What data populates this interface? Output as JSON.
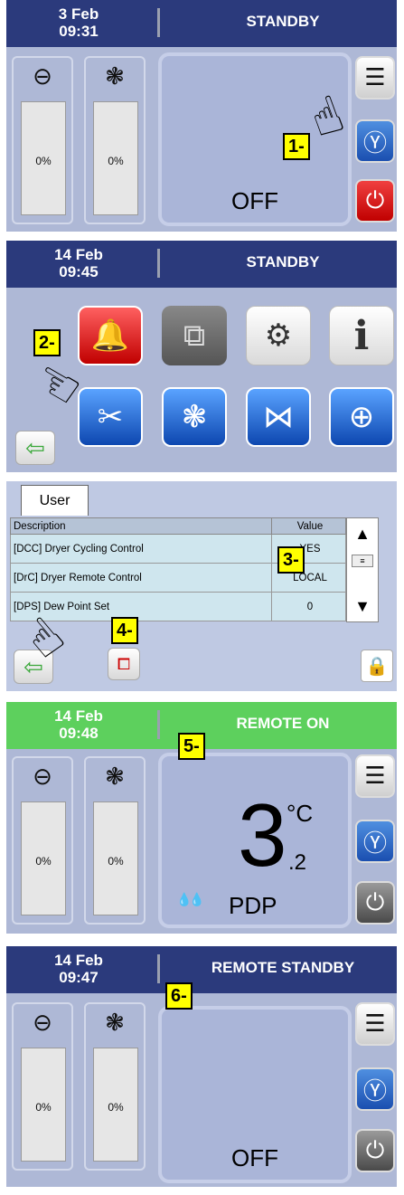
{
  "screen1": {
    "date": "3 Feb",
    "time": "09:31",
    "status": "STANDBY",
    "compressor_pct": "0%",
    "fan_pct": "0%",
    "display_text": "OFF",
    "callout": "1-"
  },
  "screen2": {
    "date": "14 Feb",
    "time": "09:45",
    "status": "STANDBY",
    "callout": "2-",
    "info_glyph": "i"
  },
  "screen3": {
    "tab": "User",
    "col_description": "Description",
    "col_value": "Value",
    "rows": [
      {
        "description": "[DCC] Dryer Cycling Control",
        "value": "YES"
      },
      {
        "description": "[DrC] Dryer Remote Control",
        "value": "LOCAL"
      },
      {
        "description": "[DPS] Dew Point Set",
        "value": "0"
      }
    ],
    "callout_table": "3-",
    "callout_back": "4-"
  },
  "screen4": {
    "date": "14 Feb",
    "time": "09:48",
    "status": "REMOTE ON",
    "compressor_pct": "0%",
    "fan_pct": "0%",
    "temp_int": "3",
    "temp_unit": "°C",
    "temp_dec": ".2",
    "pdp_label": "PDP",
    "callout": "5-",
    "header_color": "#5dd05d"
  },
  "screen5": {
    "date": "14 Feb",
    "time": "09:47",
    "status": "REMOTE STANDBY",
    "compressor_pct": "0%",
    "fan_pct": "0%",
    "display_text": "OFF",
    "callout": "6-"
  },
  "icons": {
    "compressor": "compressor-icon",
    "fan": "fan-icon",
    "menu": "menu-list-icon",
    "dryer": "dryer-icon",
    "power": "power-icon",
    "back": "back-arrow-icon",
    "lock": "lock-icon"
  },
  "colors": {
    "header_blue": "#2b3a7c",
    "header_green": "#5dd05d",
    "panel_bg": "#aeb8d6",
    "callout": "#ffff00",
    "power_red": "#e00000"
  }
}
